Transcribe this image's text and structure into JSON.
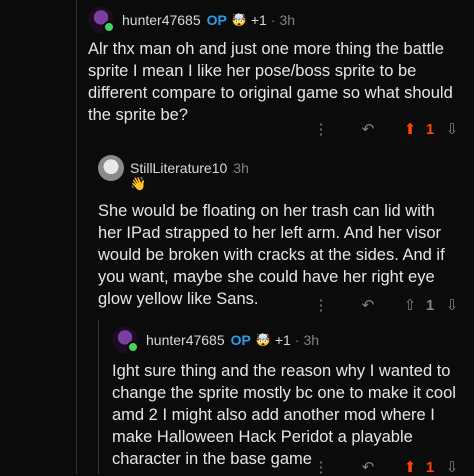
{
  "thread": [
    {
      "author": "hunter47685",
      "op_badge": "OP",
      "flair": "🤯",
      "flair_count": "+1",
      "dot": "·",
      "time": "3h",
      "body": "Alr thx man oh and just one more thing the battle sprite I mean I like her pose/boss sprite to be different compare to original game so what should the sprite be?",
      "score": "1",
      "upvoted": true,
      "icons": {
        "more": "more-vertical-icon",
        "reply": "reply-icon",
        "upvote": "upvote-icon",
        "downvote": "downvote-icon"
      }
    },
    {
      "author": "StillLiterature10",
      "time": "3h",
      "reaction": "👋",
      "body": "She would be floating on her trash can lid with her IPad strapped to her left arm. And her visor would be broken with cracks at the sides. And if you want, maybe she could have her right eye glow yellow like Sans.",
      "score": "1",
      "upvoted": false
    },
    {
      "author": "hunter47685",
      "op_badge": "OP",
      "flair": "🤯",
      "flair_count": "+1",
      "dot": "·",
      "time": "3h",
      "body": "Ight sure thing and the reason why I wanted to change the sprite mostly bc one to make it cool amd 2 I might also add another mod where I make Halloween Hack Peridot a playable character in the base game",
      "score": "1",
      "upvoted": true
    }
  ],
  "colors": {
    "background": "#0b0b0b",
    "op": "#24a0ed",
    "upvote": "#ff4500",
    "muted": "#818384"
  }
}
